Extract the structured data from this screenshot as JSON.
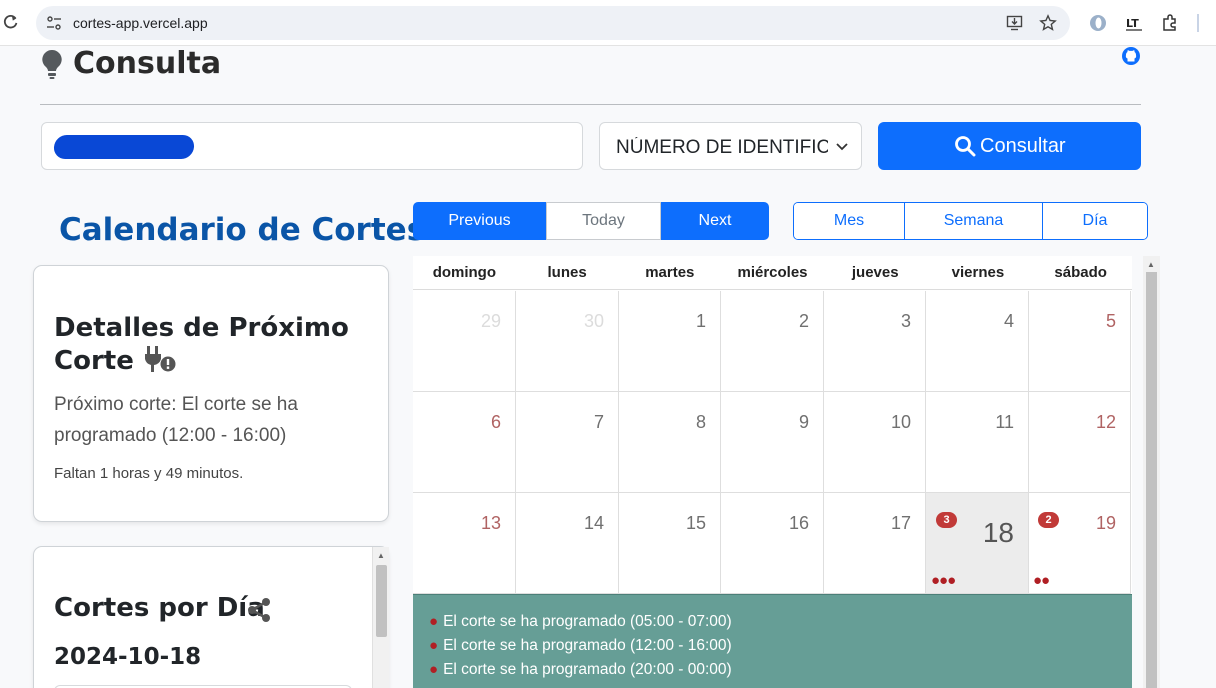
{
  "browser": {
    "url": "cortes-app.vercel.app"
  },
  "page": {
    "title": "Consulta"
  },
  "search": {
    "id_type_selected": "NÚMERO DE IDENTIFICACIÓN",
    "submit_label": "Consultar"
  },
  "calendar_heading": "Calendario de Cortes",
  "next_cut_card": {
    "title_line1": "Detalles de Próximo",
    "title_line2": "Corte",
    "message": "Próximo corte: El corte se ha programado (12:00 - 16:00)",
    "remaining": "Faltan 1 horas y 49 minutos."
  },
  "cuts_by_day_card": {
    "title": "Cortes por Día",
    "date": "2024-10-18"
  },
  "toolbar": {
    "previous": "Previous",
    "today": "Today",
    "next": "Next",
    "month": "Mes",
    "week": "Semana",
    "day": "Día"
  },
  "calendar": {
    "weekdays": [
      "domingo",
      "lunes",
      "martes",
      "miércoles",
      "jueves",
      "viernes",
      "sábado"
    ],
    "weeks": [
      [
        "29",
        "30",
        "1",
        "2",
        "3",
        "4",
        "5"
      ],
      [
        "6",
        "7",
        "8",
        "9",
        "10",
        "11",
        "12"
      ],
      [
        "13",
        "14",
        "15",
        "16",
        "17",
        "18",
        "19"
      ]
    ],
    "badges": {
      "18": "3",
      "19": "2"
    },
    "events": [
      "El corte se ha programado (05:00 - 07:00)",
      "El corte se ha programado (12:00 - 16:00)",
      "El corte se ha programado (20:00 - 00:00)"
    ]
  },
  "colors": {
    "primary": "#0d6efd",
    "heading_blue": "#0a55a7",
    "weekend_red": "#b06363",
    "badge_red": "#c13a38",
    "events_panel": "#669e96"
  }
}
